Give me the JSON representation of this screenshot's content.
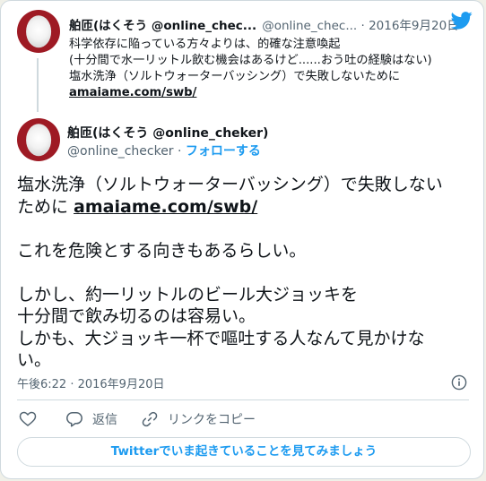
{
  "quoted_tweet": {
    "display_name": "舶匝(はくそう @online_chec...",
    "handle": "@online_chec...",
    "separator": " · ",
    "date": "2016年9月20日",
    "lines": [
      "科学依存に陥っている方々よりは、的確な注意喚起",
      "(十分間で水一リットル飲む機会はあるけど......おう吐の経験はない)",
      "塩水洗浄（ソルトウォーターバッシング）で失敗しないために"
    ],
    "link": "amaiame.com/swb/"
  },
  "main_tweet": {
    "display_name": "舶匝(はくそう @online_cheker)",
    "handle": "@online_checker",
    "separator": " · ",
    "follow_label": "フォローする",
    "body_line1": "塩水洗浄（ソルトウォーターバッシング）で失敗しない",
    "body_line2_prefix": "ために ",
    "link": "amaiame.com/swb/",
    "paragraph2": "これを危険とする向きもあるらしい。",
    "paragraph3": [
      "しかし、約一リットルのビール大ジョッキを",
      "十分間で飲み切るのは容易い。",
      "しかも、大ジョッキ一杯で嘔吐する人なんて見かけな",
      "い。"
    ],
    "timestamp": "午後6:22 · 2016年9月20日"
  },
  "actions": {
    "reply_label": "返信",
    "copy_link_label": "リンクをコピー"
  },
  "cta_label": "Twitterでいま起きていることを見てみましょう",
  "icons": [
    "twitter-bird-icon",
    "info-icon",
    "heart-icon",
    "reply-icon",
    "link-icon"
  ],
  "colors": {
    "accent": "#1d9bf0",
    "avatar_bg": "#9e1a24",
    "muted": "#536471"
  }
}
